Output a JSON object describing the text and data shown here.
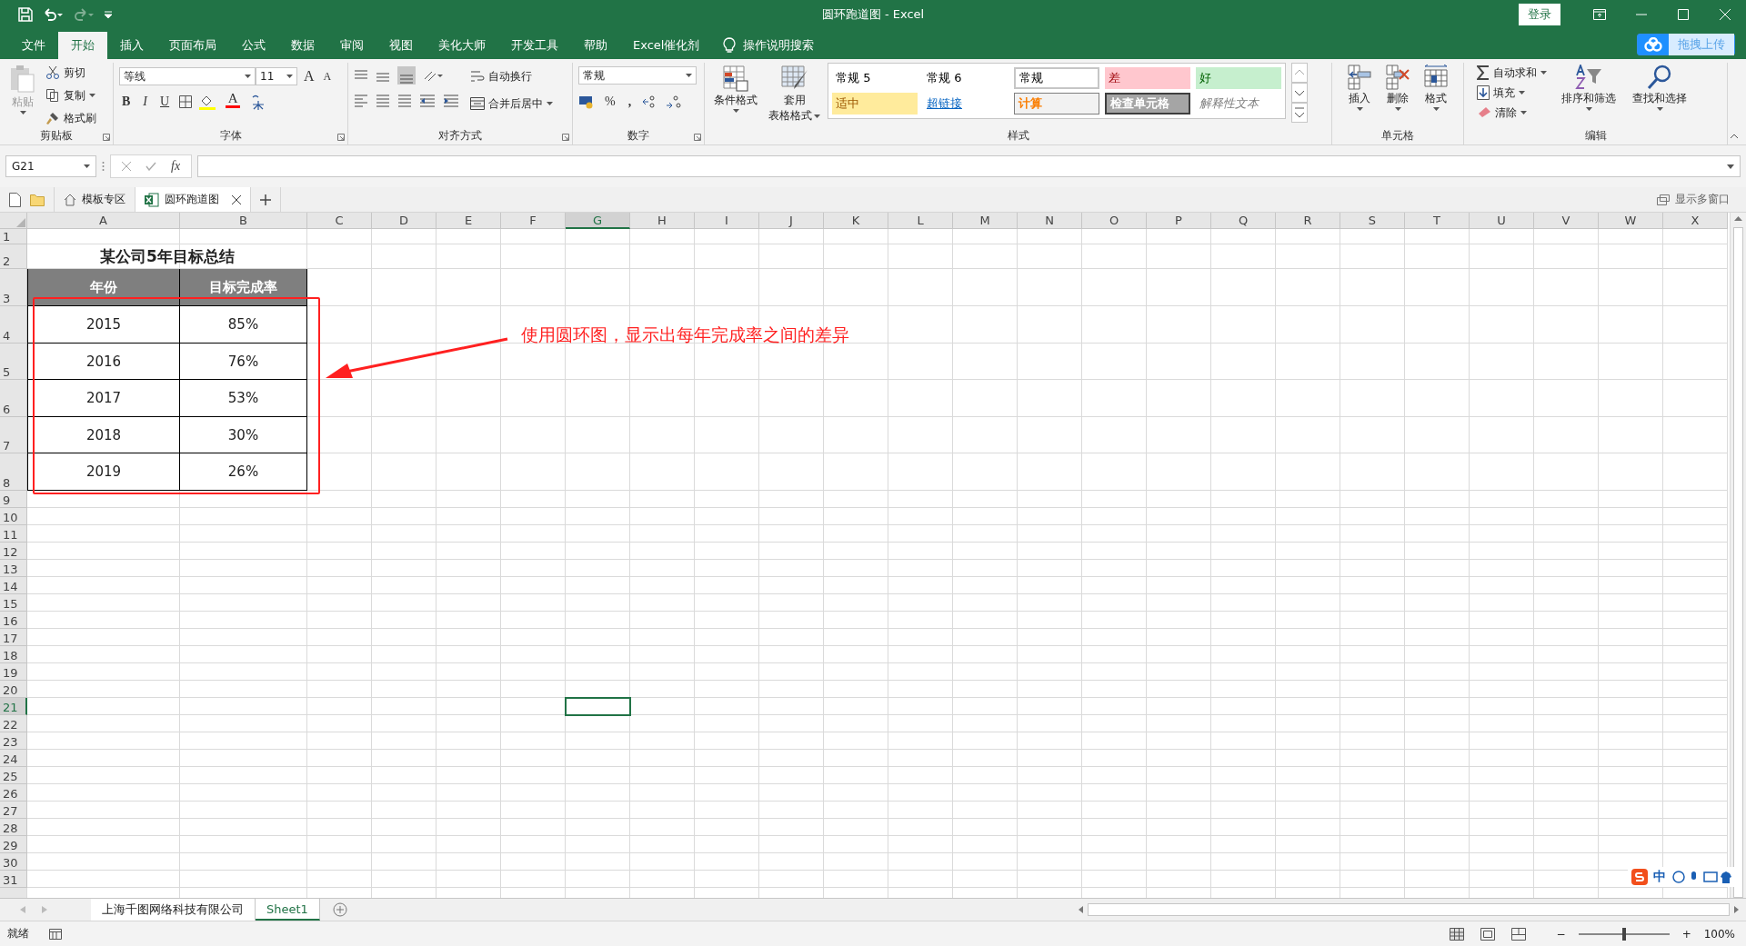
{
  "title_bar": {
    "title": "圆环跑道图  -  Excel",
    "login": "登录"
  },
  "menu_tabs": [
    {
      "label": "文件",
      "selected": false
    },
    {
      "label": "开始",
      "selected": true
    },
    {
      "label": "插入",
      "selected": false
    },
    {
      "label": "页面布局",
      "selected": false
    },
    {
      "label": "公式",
      "selected": false
    },
    {
      "label": "数据",
      "selected": false
    },
    {
      "label": "审阅",
      "selected": false
    },
    {
      "label": "视图",
      "selected": false
    },
    {
      "label": "美化大师",
      "selected": false
    },
    {
      "label": "开发工具",
      "selected": false
    },
    {
      "label": "帮助",
      "selected": false
    },
    {
      "label": "Excel催化剂",
      "selected": false
    }
  ],
  "tell_me": "操作说明搜索",
  "upload": "拖拽上传",
  "ribbon": {
    "clipboard": {
      "label": "剪贴板",
      "paste": "粘贴",
      "paste_disabled": true,
      "cut": "剪切",
      "copy": "复制",
      "format_painter": "格式刷"
    },
    "font": {
      "label": "字体",
      "font_name": "等线",
      "font_size": "11",
      "grow": "A",
      "shrink": "A",
      "bold": "B",
      "italic": "I",
      "underline": "U",
      "font_color": "A"
    },
    "alignment": {
      "label": "对齐方式",
      "wrap": "自动换行",
      "merge": "合并后居中"
    },
    "number": {
      "label": "数字",
      "format": "常规",
      "percent": "%",
      "comma": ","
    },
    "styles": {
      "label": "样式",
      "conditional": "条件格式",
      "table_format": [
        "套用",
        "表格格式"
      ],
      "gallery": [
        {
          "text": "常规 5",
          "kind": "plain"
        },
        {
          "text": "常规 6",
          "kind": "plain"
        },
        {
          "text": "常规",
          "kind": "normal"
        },
        {
          "text": "差",
          "kind": "bad"
        },
        {
          "text": "好",
          "kind": "good"
        },
        {
          "text": "适中",
          "kind": "neutral"
        },
        {
          "text": "超链接",
          "kind": "hyperlink"
        },
        {
          "text": "计算",
          "kind": "calculation"
        },
        {
          "text": "检查单元格",
          "kind": "check"
        },
        {
          "text": "解释性文本",
          "kind": "explanatory"
        }
      ]
    },
    "cells": {
      "label": "单元格",
      "insert": "插入",
      "delete": "删除",
      "format": "格式"
    },
    "editing": {
      "label": "编辑",
      "autosum": "自动求和",
      "fill": "填充",
      "clear": "清除",
      "sort_filter": "排序和筛选",
      "find_select": "查找和选择"
    }
  },
  "formula_bar": {
    "name_box": "G21",
    "fx": "fx"
  },
  "doc_tabs": {
    "template": "模板专区",
    "file": "圆环跑道图",
    "multi_window": "显示多窗口"
  },
  "sheet": {
    "columns": [
      {
        "label": "A",
        "selected": false
      },
      {
        "label": "B",
        "selected": false
      },
      {
        "label": "C",
        "selected": false
      },
      {
        "label": "D",
        "selected": false
      },
      {
        "label": "E",
        "selected": false
      },
      {
        "label": "F",
        "selected": false
      },
      {
        "label": "G",
        "selected": true
      },
      {
        "label": "H",
        "selected": false
      },
      {
        "label": "I",
        "selected": false
      },
      {
        "label": "J",
        "selected": false
      },
      {
        "label": "K",
        "selected": false
      },
      {
        "label": "L",
        "selected": false
      },
      {
        "label": "M",
        "selected": false
      },
      {
        "label": "N",
        "selected": false
      },
      {
        "label": "O",
        "selected": false
      },
      {
        "label": "P",
        "selected": false
      },
      {
        "label": "Q",
        "selected": false
      },
      {
        "label": "R",
        "selected": false
      },
      {
        "label": "S",
        "selected": false
      },
      {
        "label": "T",
        "selected": false
      },
      {
        "label": "U",
        "selected": false
      },
      {
        "label": "V",
        "selected": false
      },
      {
        "label": "W",
        "selected": false
      },
      {
        "label": "X",
        "selected": false
      }
    ],
    "rows": [
      {
        "label": "1",
        "selected": false
      },
      {
        "label": "2",
        "selected": false
      },
      {
        "label": "3",
        "selected": false
      },
      {
        "label": "4",
        "selected": false
      },
      {
        "label": "5",
        "selected": false
      },
      {
        "label": "6",
        "selected": false
      },
      {
        "label": "7",
        "selected": false
      },
      {
        "label": "8",
        "selected": false
      },
      {
        "label": "9",
        "selected": false
      },
      {
        "label": "10",
        "selected": false
      },
      {
        "label": "11",
        "selected": false
      },
      {
        "label": "12",
        "selected": false
      },
      {
        "label": "13",
        "selected": false
      },
      {
        "label": "14",
        "selected": false
      },
      {
        "label": "15",
        "selected": false
      },
      {
        "label": "16",
        "selected": false
      },
      {
        "label": "17",
        "selected": false
      },
      {
        "label": "18",
        "selected": false
      },
      {
        "label": "19",
        "selected": false
      },
      {
        "label": "20",
        "selected": false
      },
      {
        "label": "21",
        "selected": true
      },
      {
        "label": "22",
        "selected": false
      },
      {
        "label": "23",
        "selected": false
      },
      {
        "label": "24",
        "selected": false
      },
      {
        "label": "25",
        "selected": false
      },
      {
        "label": "26",
        "selected": false
      },
      {
        "label": "27",
        "selected": false
      },
      {
        "label": "28",
        "selected": false
      },
      {
        "label": "29",
        "selected": false
      },
      {
        "label": "30",
        "selected": false
      },
      {
        "label": "31",
        "selected": false
      }
    ],
    "title": "某公司5年目标总结",
    "table": {
      "columns": [
        "年份",
        "目标完成率"
      ],
      "rows": [
        [
          "2015",
          "85%"
        ],
        [
          "2016",
          "76%"
        ],
        [
          "2017",
          "53%"
        ],
        [
          "2018",
          "30%"
        ],
        [
          "2019",
          "26%"
        ]
      ]
    }
  },
  "annotation": "使用圆环图，显示出每年完成率之间的差异",
  "sheet_tabs": [
    {
      "label": "上海千图网络科技有限公司",
      "selected": false
    },
    {
      "label": "Sheet1",
      "selected": true
    }
  ],
  "status_bar": {
    "status": "就绪",
    "zoom_out": "−",
    "zoom": {
      "level": 0.5
    },
    "zoom_in": "+",
    "zoom_text": "100%"
  },
  "ime": {
    "label": "中"
  }
}
